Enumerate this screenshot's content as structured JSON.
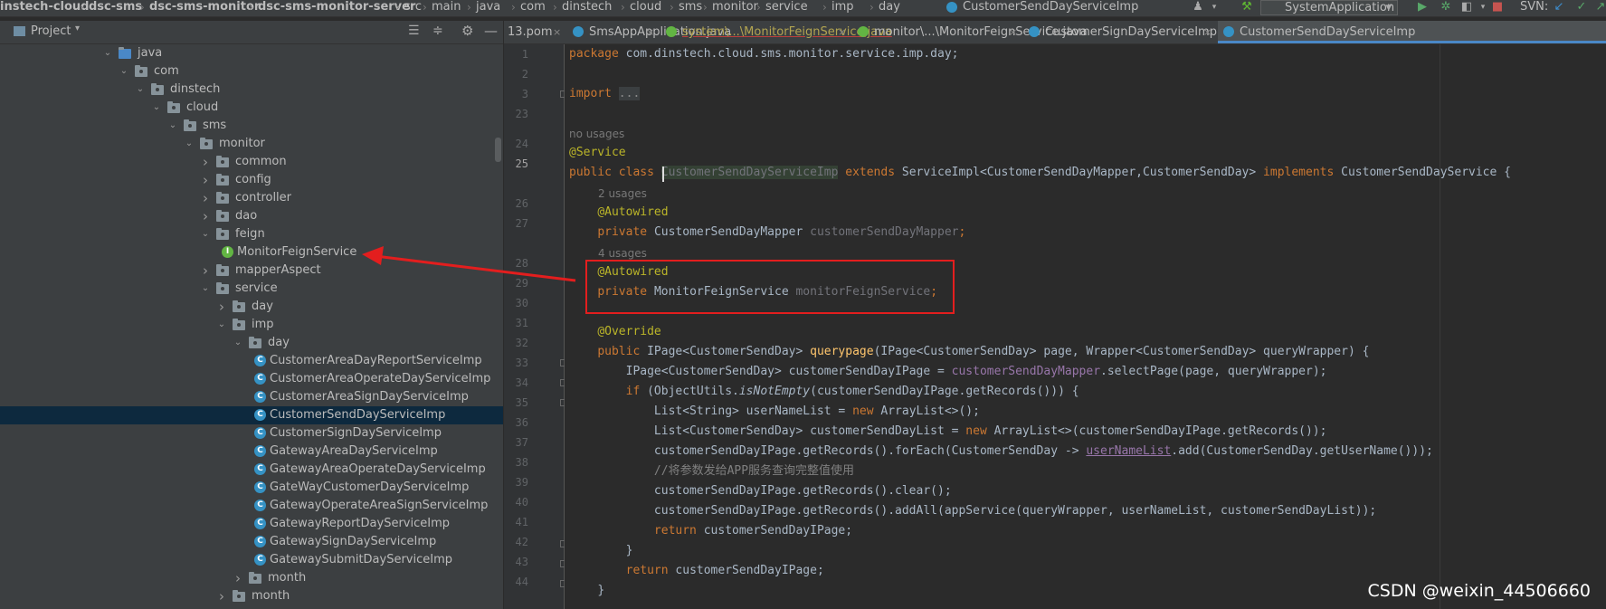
{
  "breadcrumb": [
    "instech-cloud",
    "dsc-sms",
    "dsc-sms-monitor",
    "dsc-sms-monitor-server",
    "src",
    "main",
    "java",
    "com",
    "dinstech",
    "cloud",
    "sms",
    "monitor",
    "service",
    "imp",
    "day",
    "CustomerSendDayServiceImp"
  ],
  "toolbar": {
    "run_config": "SystemApplication",
    "svn_label": "SVN:"
  },
  "project_panel": {
    "title": "Project"
  },
  "tree": [
    {
      "label": "java",
      "type": "folder",
      "expanded": true
    },
    {
      "label": "com",
      "type": "pkg",
      "expanded": true
    },
    {
      "label": "dinstech",
      "type": "pkg",
      "expanded": true
    },
    {
      "label": "cloud",
      "type": "pkg",
      "expanded": true
    },
    {
      "label": "sms",
      "type": "pkg",
      "expanded": true
    },
    {
      "label": "monitor",
      "type": "pkg",
      "expanded": true
    },
    {
      "label": "common",
      "type": "pkg",
      "expanded": false
    },
    {
      "label": "config",
      "type": "pkg",
      "expanded": false
    },
    {
      "label": "controller",
      "type": "pkg",
      "expanded": false
    },
    {
      "label": "dao",
      "type": "pkg",
      "expanded": false
    },
    {
      "label": "feign",
      "type": "pkg",
      "expanded": true
    },
    {
      "label": "MonitorFeignService",
      "type": "interface"
    },
    {
      "label": "mapperAspect",
      "type": "pkg",
      "expanded": false
    },
    {
      "label": "service",
      "type": "pkg",
      "expanded": true
    },
    {
      "label": "day",
      "type": "pkg",
      "expanded": false
    },
    {
      "label": "imp",
      "type": "pkg",
      "expanded": true
    },
    {
      "label": "day",
      "type": "pkg",
      "expanded": true
    },
    {
      "label": "CustomerAreaDayReportServiceImp",
      "type": "class"
    },
    {
      "label": "CustomerAreaOperateDayServiceImp",
      "type": "class"
    },
    {
      "label": "CustomerAreaSignDayServiceImp",
      "type": "class"
    },
    {
      "label": "CustomerSendDayServiceImp",
      "type": "class",
      "selected": true
    },
    {
      "label": "CustomerSignDayServiceImp",
      "type": "class"
    },
    {
      "label": "GatewayAreaDayServiceImp",
      "type": "class"
    },
    {
      "label": "GatewayAreaOperateDayServiceImp",
      "type": "class"
    },
    {
      "label": "GateWayCustomerDayServiceImp",
      "type": "class"
    },
    {
      "label": "GatewayOperateAreaSignServiceImp",
      "type": "class"
    },
    {
      "label": "GatewayReportDayServiceImp",
      "type": "class"
    },
    {
      "label": "GatewaySignDayServiceImp",
      "type": "class"
    },
    {
      "label": "GatewaySubmitDayServiceImp",
      "type": "class"
    },
    {
      "label": "month",
      "type": "pkg",
      "expanded": false
    },
    {
      "label": "month",
      "type": "pkg",
      "expanded": false
    }
  ],
  "tabs": [
    {
      "label": "13.pom",
      "type": "file",
      "close": "×"
    },
    {
      "label": "SmsAppApplication.java",
      "type": "class",
      "close": "×"
    },
    {
      "label": "system\\...\\MonitorFeignService.java",
      "type": "interface",
      "warn": true,
      "close": "×"
    },
    {
      "label": "monitor\\...\\MonitorFeignService.java",
      "type": "interface",
      "close": "×"
    },
    {
      "label": "CustomerSignDayServiceImp.java",
      "type": "class",
      "close": "×"
    },
    {
      "label": "CustomerSendDayServiceImp",
      "type": "class",
      "active": true
    }
  ],
  "code": {
    "line_numbers": [
      "1",
      "2",
      "3",
      "23",
      "24",
      "25",
      "26",
      "27",
      "28",
      "29",
      "30",
      "31",
      "32",
      "33",
      "34",
      "35",
      "36",
      "37",
      "38",
      "39",
      "40",
      "41",
      "42",
      "43",
      "44"
    ],
    "package_kw": "package",
    "package_name": " com.dinstech.cloud.sms.monitor.service.imp.day;",
    "import_kw": "import",
    "import_fold": "...",
    "no_usages": "no usages",
    "service_ann": "@Service",
    "class_kw": "public class ",
    "class_name": "CustomerSendDayServiceImp",
    "extends_kw": " extends ",
    "extends_rest": "ServiceImpl<CustomerSendDayMapper,CustomerSendDay>",
    "implements_kw": " implements ",
    "implements_rest": "CustomerSendDayService {",
    "usages2": "2 usages",
    "autowired": "@Autowired",
    "private_kw": "private ",
    "mapper_type": "CustomerSendDayMapper ",
    "mapper_field": "customerSendDayMapper",
    "semicolon": ";",
    "usages4": "4 usages",
    "feign_type": "MonitorFeignService ",
    "feign_field": "monitorFeignService",
    "override": "@Override",
    "public_kw": "public ",
    "method_ret": "IPage<CustomerSendDay> ",
    "method_name": "querypage",
    "method_params": "(IPage<CustomerSendDay> page, Wrapper<CustomerSendDay> queryWrapper) {",
    "l33a": "IPage<CustomerSendDay> customerSendDayIPage = ",
    "l33b": "customerSendDayMapper",
    "l33c": ".selectPage(page, queryWrapper);",
    "if_kw": "if ",
    "l34a": "(ObjectUtils.",
    "l34b": "isNotEmpty",
    "l34c": "(customerSendDayIPage.getRecords())) {",
    "l35a": "List<String> userNameList = ",
    "new_kw": "new ",
    "l35b": "ArrayList<>();",
    "l36a": "List<CustomerSendDay> customerSendDayList = ",
    "l36b": "ArrayList<>(customerSendDayIPage.getRecords());",
    "l37a": "customerSendDayIPage.getRecords().forEach(CustomerSendDay -> ",
    "l37b": "userNameList",
    "l37c": ".add(CustomerSendDay.getUserName()));",
    "l38": "//将参数发给APP服务查询完整值使用",
    "l39": "customerSendDayIPage.getRecords().clear();",
    "l40": "customerSendDayIPage.getRecords().addAll(appService(queryWrapper, userNameList, customerSendDayList));",
    "return_kw": "return ",
    "l41": "customerSendDayIPage;",
    "close_brace": "}",
    "l43": "customerSendDayIPage;"
  },
  "watermark": "CSDN @weixin_44506660",
  "colors": {
    "annotation_box": "#e31e1e",
    "arrow": "#e31e1e",
    "keyword": "#cc7832",
    "annotation": "#bbb529",
    "field": "#9876aa"
  }
}
